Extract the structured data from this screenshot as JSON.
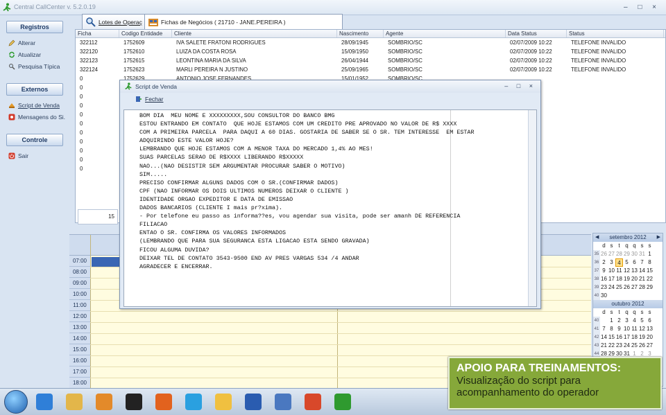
{
  "window": {
    "title": "Central CallCenter  v. 5.2.0.19",
    "controls": "–  □  ×"
  },
  "sidebar": {
    "sections": [
      {
        "header": "Registros",
        "items": [
          {
            "label": "Alterar",
            "icon": "pencil-icon"
          },
          {
            "label": "Atualizar",
            "icon": "refresh-icon"
          },
          {
            "label": "Pesquisa Típica",
            "icon": "search-icon"
          }
        ]
      },
      {
        "header": "Externos",
        "items": [
          {
            "label": "Script de Venda",
            "icon": "script-icon"
          },
          {
            "label": "Mensagens do Si...",
            "icon": "messages-icon"
          }
        ]
      },
      {
        "header": "Controle",
        "items": [
          {
            "label": "Sair",
            "icon": "exit-icon"
          }
        ]
      }
    ]
  },
  "tabs": [
    {
      "label": "Lotes de Operaç",
      "icon": "lotes-icon"
    },
    {
      "label": "Fichas de Negócios ( 21710 - JANE.PEREIRA )",
      "icon": "fichas-icon"
    }
  ],
  "grid": {
    "columns": [
      "Ficha",
      "Codigo Entidade",
      "Cliente",
      "Nascimento",
      "Agente",
      "Data Status",
      "Status"
    ],
    "rows": [
      [
        "322112",
        "1752609",
        "IVA SALETE FRATONI RODRIGUES",
        "28/09/1945",
        "SOMBRIO/SC",
        "02/07/2009 10:22",
        "TELEFONE INVALIDO"
      ],
      [
        "322120",
        "1752610",
        "LUIZA DA COSTA ROSA",
        "15/09/1950",
        "SOMBRIO/SC",
        "02/07/2009 10:22",
        "TELEFONE INVALIDO"
      ],
      [
        "322123",
        "1752615",
        "LEONTINA MARIA DA SILVA",
        "26/04/1944",
        "SOMBRIO/SC",
        "02/07/2009 10:22",
        "TELEFONE INVALIDO"
      ],
      [
        "322124",
        "1752623",
        "MARLI PEREIRA N JUSTINO",
        "25/09/1965",
        "SOMBRIO/SC",
        "02/07/2009 10:22",
        "TELEFONE INVALIDO"
      ],
      [
        "0",
        "1752629",
        "ANTONIO JOSE FERNANDES",
        "15/01/1952",
        "SOMBRIO/SC",
        "",
        ""
      ],
      [
        "0",
        "",
        "",
        "",
        "",
        "",
        ""
      ],
      [
        "0",
        "",
        "",
        "",
        "",
        "",
        ""
      ],
      [
        "0",
        "",
        "",
        "",
        "",
        "",
        ""
      ],
      [
        "0",
        "",
        "",
        "",
        "",
        "",
        ""
      ],
      [
        "0",
        "",
        "",
        "",
        "",
        "",
        ""
      ],
      [
        "0",
        "",
        "",
        "",
        "",
        "",
        ""
      ],
      [
        "0",
        "",
        "",
        "",
        "",
        "",
        ""
      ],
      [
        "0",
        "",
        "",
        "",
        "",
        "",
        ""
      ],
      [
        "0",
        "",
        "",
        "",
        "",
        "",
        ""
      ],
      [
        "0",
        "",
        "",
        "",
        "",
        "",
        ""
      ]
    ],
    "count": "15"
  },
  "calendar": {
    "times": [
      "07:00",
      "08:00",
      "09:00",
      "10:00",
      "11:00",
      "12:00",
      "13:00",
      "14:00",
      "15:00",
      "16:00",
      "17:00",
      "18:00"
    ]
  },
  "minical": {
    "months": [
      {
        "title": "setembro 2012",
        "days": [
          "d",
          "s",
          "t",
          "q",
          "q",
          "s",
          "s"
        ],
        "weeks": [
          {
            "wk": "35",
            "d": [
              "26",
              "27",
              "28",
              "29",
              "30",
              "31",
              "1"
            ]
          },
          {
            "wk": "36",
            "d": [
              "2",
              "3",
              "4",
              "5",
              "6",
              "7",
              "8"
            ]
          },
          {
            "wk": "37",
            "d": [
              "9",
              "10",
              "11",
              "12",
              "13",
              "14",
              "15"
            ]
          },
          {
            "wk": "38",
            "d": [
              "16",
              "17",
              "18",
              "19",
              "20",
              "21",
              "22"
            ]
          },
          {
            "wk": "39",
            "d": [
              "23",
              "24",
              "25",
              "26",
              "27",
              "28",
              "29"
            ]
          },
          {
            "wk": "40",
            "d": [
              "30",
              "",
              "",
              "",
              "",
              "",
              ""
            ]
          }
        ]
      },
      {
        "title": "outubro 2012",
        "days": [
          "d",
          "s",
          "t",
          "q",
          "q",
          "s",
          "s"
        ],
        "weeks": [
          {
            "wk": "40",
            "d": [
              "",
              "1",
              "2",
              "3",
              "4",
              "5",
              "6"
            ]
          },
          {
            "wk": "41",
            "d": [
              "7",
              "8",
              "9",
              "10",
              "11",
              "12",
              "13"
            ]
          },
          {
            "wk": "42",
            "d": [
              "14",
              "15",
              "16",
              "17",
              "18",
              "19",
              "20"
            ]
          },
          {
            "wk": "43",
            "d": [
              "21",
              "22",
              "23",
              "24",
              "25",
              "26",
              "27"
            ]
          },
          {
            "wk": "44",
            "d": [
              "28",
              "29",
              "30",
              "31",
              "1",
              "2",
              "3"
            ]
          }
        ]
      }
    ],
    "today": "4"
  },
  "dialog": {
    "title": "Script de Venda",
    "controls": "–  □  ×",
    "close_label": "Fechar",
    "script": "BOM DIA  MEU NOME E XXXXXXXXX,SOU CONSULTOR DO BANCO BMG\nESTOU ENTRANDO EM CONTATO  QUE HOJE ESTAMOS COM UM CREDITO PRE APROVADO NO VALOR DE R$ XXXX\nCOM A PRIMEIRA PARCELA  PARA DAQUI A 60 DIAS. GOSTARIA DE SABER SE O SR. TEM INTERESSE  EM ESTAR\nADQUIRINDO ESTE VALOR HOJE?\nLEMBRANDO QUE HOJE ESTAMOS COM A MENOR TAXA DO MERCADO 1,4% AO MES!\nSUAS PARCELAS SERAO DE R$XXXX LIBERANDO R$XXXXX\nNAO...(NAO DESISTIR SEM ARGUMENTAR PROCURAR SABER O MOTIVO)\nSIM.....\nPRECISO CONFIRMAR ALGUNS DADOS COM O SR.(CONFIRMAR DADOS)\nCPF (NAO INFORMAR OS DOIS ULTIMOS NUMEROS DEIXAR O CLIENTE )\nIDENTIDADE ORGAO EXPEDITOR E DATA DE EMISSAO\nDADOS BANCARIOS (CLIENTE I mais pr?xima).\n- Por telefone eu passo as informa??es, vou agendar sua visita, pode ser amanh DE REFERENCIA\nFILIACAO\nENTAO O SR. CONFIRMA OS VALORES INFORMADOS\n(LEMBRANDO QUE PARA SUA SEGURANCA ESTA LIGACAO ESTA SENDO GRAVADA)\nFICOU ALGUMA DUVIDA?\nDEIXAR TEL DE CONTATO 3543-9500 END AV PRES VARGAS 534 /4 ANDAR\nAGRADECER E ENCERRAR."
  },
  "taskbar": {
    "apps": [
      "start-orb-icon",
      "internet-explorer-icon",
      "file-explorer-icon",
      "media-player-icon",
      "hp-icon",
      "firefox-icon",
      "skype-icon",
      "mail-icon",
      "word-icon",
      "network-icon",
      "powerpoint-icon",
      "callcenter-icon"
    ]
  },
  "overlay": {
    "title": "APOIO PARA TREINAMENTOS:",
    "line1": "Visualização do script para",
    "line2": "acompanhamento do operador"
  },
  "colors": {
    "accent": "#3a66b4",
    "overlay_bg": "#86a83a",
    "calendar_bg": "#fffce0"
  }
}
